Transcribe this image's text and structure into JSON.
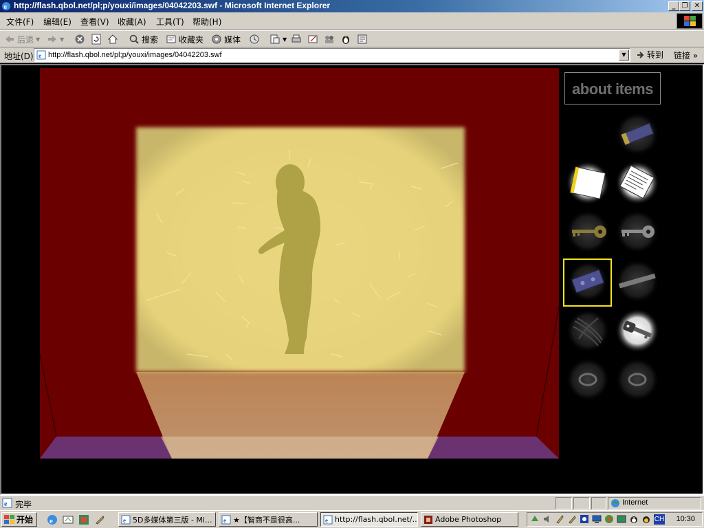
{
  "window": {
    "title": "http://flash.qbol.net/pl;p/youxi/images/04042203.swf - Microsoft Internet Explorer"
  },
  "menu": {
    "items": [
      "文件(F)",
      "编辑(E)",
      "查看(V)",
      "收藏(A)",
      "工具(T)",
      "帮助(H)"
    ]
  },
  "toolbar": {
    "back": "后退",
    "search": "搜索",
    "favorites": "收藏夹",
    "media": "媒体"
  },
  "address": {
    "label": "地址(D)",
    "url": "http://flash.qbol.net/pl;p/youxi/images/04042203.swf",
    "go": "转到",
    "links": "链接"
  },
  "game": {
    "about_label": "about items",
    "items": [
      {
        "name": "eraser",
        "state": "dim"
      },
      {
        "name": "blank-paper",
        "state": "lit"
      },
      {
        "name": "note-paper",
        "state": "lit"
      },
      {
        "name": "gold-key",
        "state": "dim"
      },
      {
        "name": "silver-key",
        "state": "dim"
      },
      {
        "name": "blue-plate",
        "state": "selected"
      },
      {
        "name": "metal-bar",
        "state": "dim"
      },
      {
        "name": "wire-coil",
        "state": "dim"
      },
      {
        "name": "car-key",
        "state": "lit"
      },
      {
        "name": "ring",
        "state": "dim"
      },
      {
        "name": "ring",
        "state": "dim"
      }
    ],
    "colors": {
      "curtain": "#6b0000",
      "screen": "#e6d27a",
      "silhouette": "#aea146",
      "floor": "#6a3270",
      "selection": "#f4e41c"
    }
  },
  "status": {
    "text": "完毕",
    "zone": "Internet"
  },
  "taskbar": {
    "start": "开始",
    "tasks": [
      {
        "label": "5D多媒体第三版 - Mi..."
      },
      {
        "label": "★【智商不是很高..."
      },
      {
        "label": "http://flash.qbol.net/..."
      },
      {
        "label": "Adobe Photoshop"
      }
    ],
    "lang": "CH",
    "clock": "10:30"
  }
}
